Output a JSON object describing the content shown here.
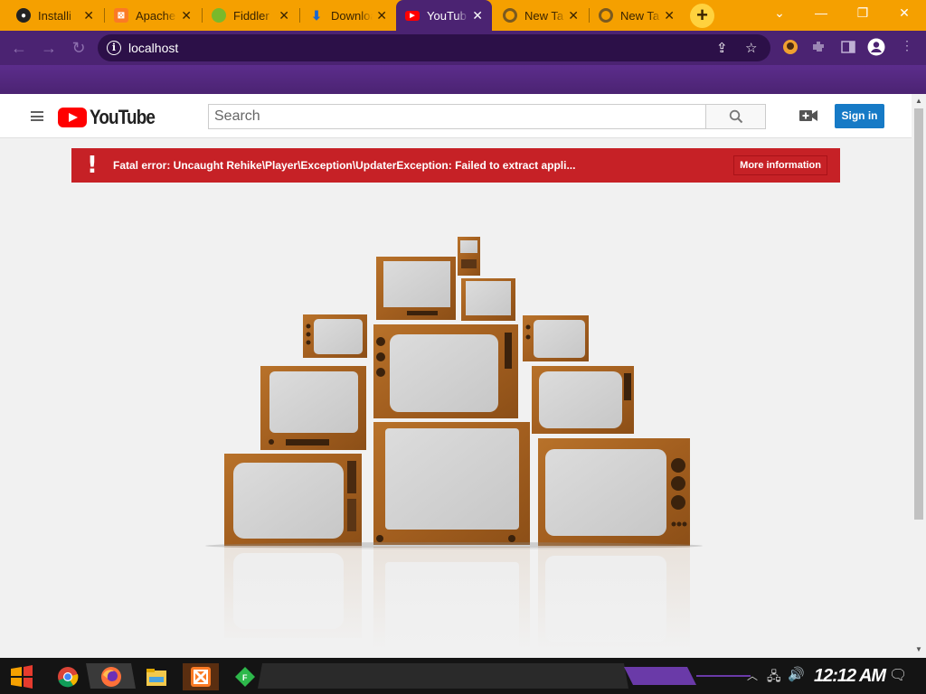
{
  "browser": {
    "tabs": [
      {
        "label": "Installi",
        "favicon": "github-icon",
        "active": false
      },
      {
        "label": "Apache",
        "favicon": "xampp-icon",
        "active": false
      },
      {
        "label": "Fiddler",
        "favicon": "fiddler-icon",
        "active": false
      },
      {
        "label": "Downloa",
        "favicon": "download-icon",
        "active": false
      },
      {
        "label": "YouTub",
        "favicon": "youtube-icon",
        "active": true
      },
      {
        "label": "New Ta",
        "favicon": "chrome-icon",
        "active": false
      },
      {
        "label": "New Ta",
        "favicon": "chrome-icon",
        "active": false
      }
    ],
    "new_tab_symbol": "+",
    "close_symbol": "✕",
    "address": "localhost"
  },
  "youtube": {
    "logo_text": "YouTube",
    "search_placeholder": "Search",
    "signin_label": "Sign in",
    "error_message": "Fatal error: Uncaught Rehike\\Player\\Exception\\UpdaterException: Failed to extract appli...",
    "error_mark": "!",
    "more_info_label": "More information"
  },
  "taskbar": {
    "time": "12:12 AM",
    "apps": [
      "start-icon",
      "chrome-icon",
      "firefox-icon",
      "file-explorer-icon",
      "xampp-icon",
      "fiddler-icon"
    ]
  },
  "colors": {
    "tab_strip": "#f5a000",
    "toolbar": "#4b2372",
    "error_red": "#c62126",
    "signin_blue": "#167ac6",
    "youtube_red": "#ff0000"
  }
}
